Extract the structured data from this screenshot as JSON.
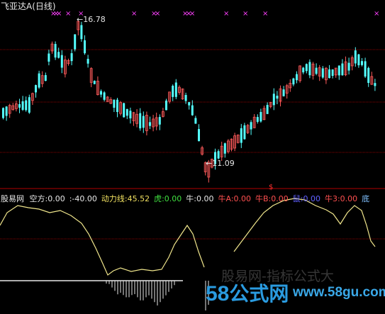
{
  "header": {
    "stock_name": "飞亚达A",
    "period": "(日线)"
  },
  "price_panel": {
    "high_label": "16.78",
    "low_label": "11.09",
    "signal_mark": "$"
  },
  "indicator_bar": {
    "name": "股易网",
    "fields": [
      {
        "label": "空方:",
        "value": "0.00",
        "color": "#e8e8e8"
      },
      {
        "label": ":",
        "value": "-40.00",
        "color": "#e8e8e8"
      },
      {
        "label": "动力线:",
        "value": "45.52",
        "color": "#f0e060"
      },
      {
        "label": "虎:",
        "value": "0.00",
        "color": "#40e040"
      },
      {
        "label": "牛:",
        "value": "0.00",
        "color": "#e8e8e8"
      },
      {
        "label": "牛A:",
        "value": "0.00",
        "color": "#ff5050"
      },
      {
        "label": "牛B:",
        "value": "0.00",
        "color": "#ff5050"
      },
      {
        "label": "鼠:",
        "value": "0.00",
        "color": "#6060ff"
      },
      {
        "label": "牛3:",
        "value": "0.00",
        "color": "#ff5050"
      },
      {
        "label": "底",
        "value": "",
        "color": "#80c0ff"
      }
    ]
  },
  "watermark": {
    "brand": "58",
    "brand_suffix": "公式网",
    "url": "www.58gu.com",
    "faded_text": "股易网-指标公式大"
  },
  "colors": {
    "up": "#ff5a5a",
    "down": "#54ffff",
    "grid": "#8b0000",
    "marker": "#ff40ff",
    "line": "#f0e68c"
  }
}
